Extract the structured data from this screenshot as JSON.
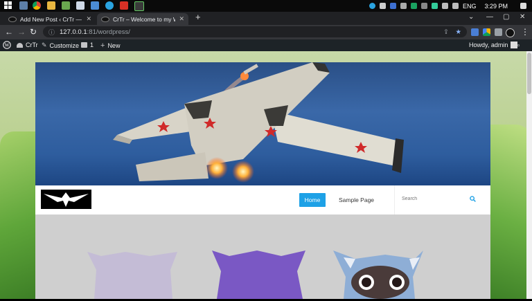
{
  "taskbar": {
    "icons": [
      "start-icon",
      "file-explorer-icon",
      "chrome-icon",
      "folder-icon",
      "app-icon",
      "notepad-icon",
      "app-icon-2",
      "telegram-icon",
      "wps-icon",
      "calculator-icon"
    ],
    "tray": {
      "language": "ENG",
      "time": "3:29 PM"
    }
  },
  "browser": {
    "tabs": [
      {
        "title": "Add New Post ‹ CrTr — WordPress",
        "active": false
      },
      {
        "title": "CrTr – Welcome to my WordPress",
        "active": true
      }
    ],
    "new_tab": "+",
    "url_host": "127.0.0.1",
    "url_path": ":81/wordpress/"
  },
  "wp_admin_bar": {
    "site_name": "CrTr",
    "customize": "Customize",
    "comments_count": "1",
    "new": "New",
    "howdy": "Howdy, admin"
  },
  "site": {
    "nav": {
      "home": "Home",
      "sample_page": "Sample Page"
    },
    "search_placeholder": "Search"
  },
  "colors": {
    "accent": "#1ea1e6",
    "admin_bar": "#1d2327"
  }
}
